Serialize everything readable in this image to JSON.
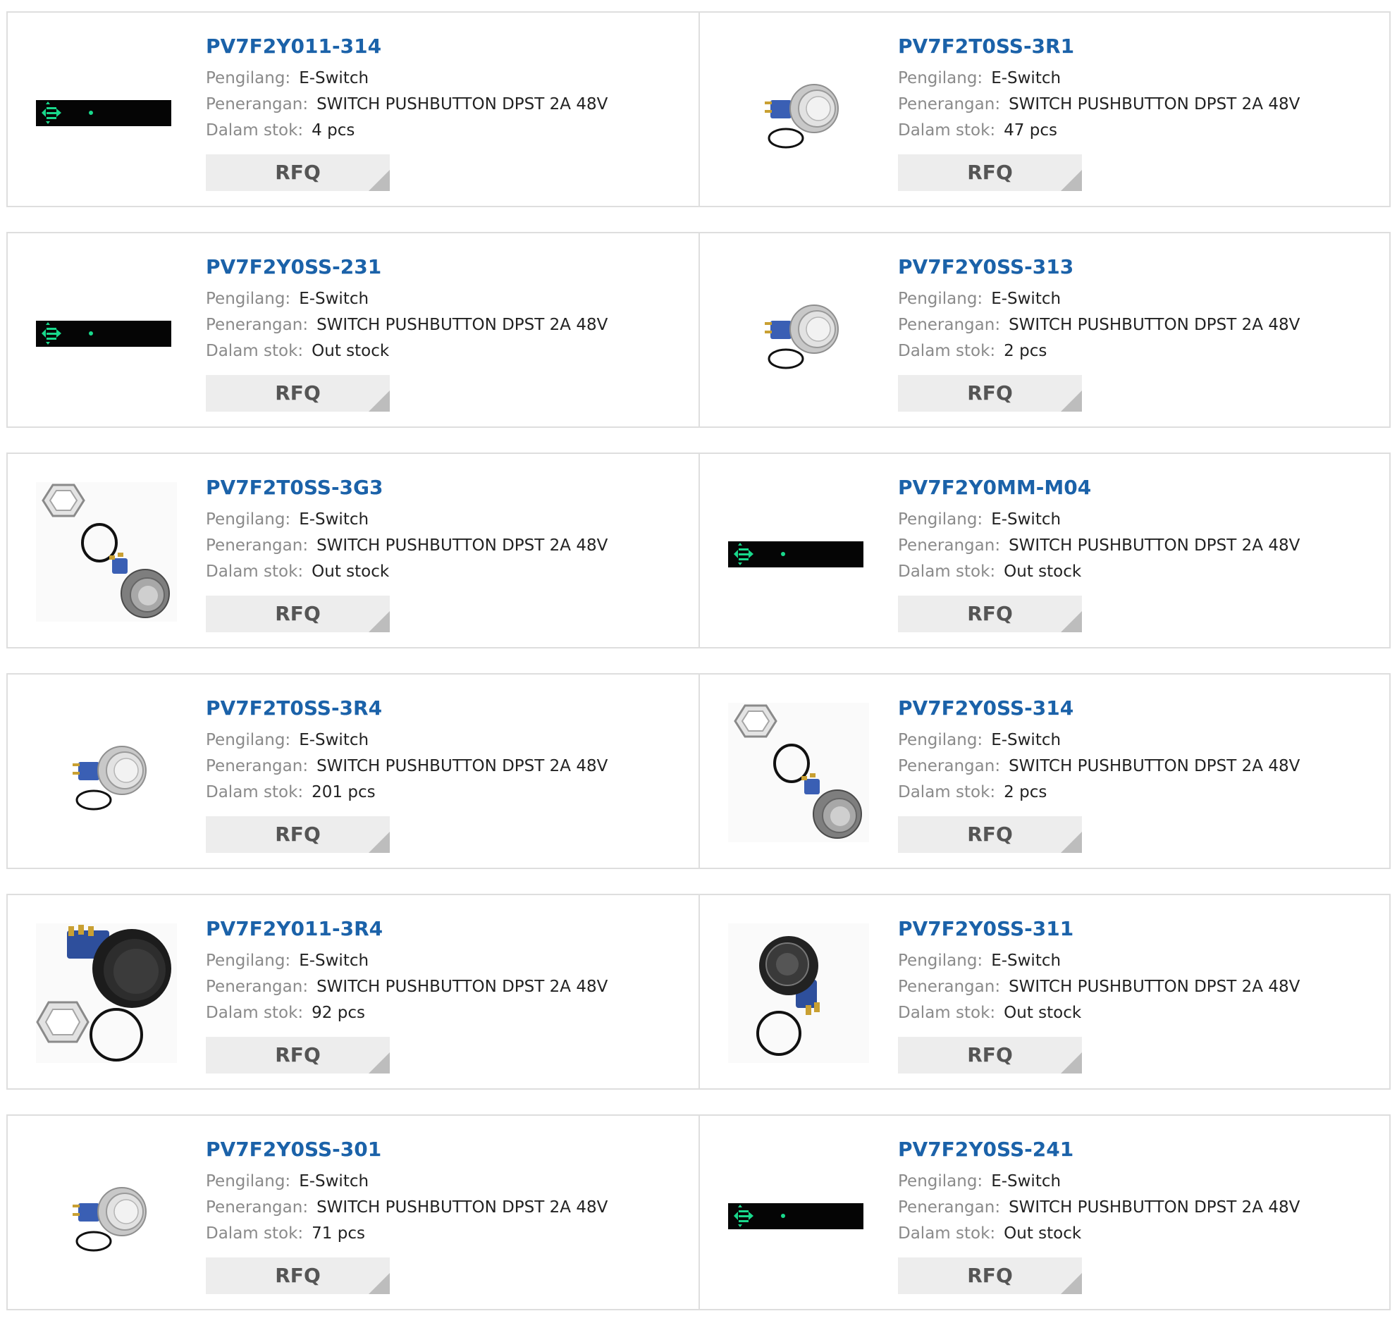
{
  "labels": {
    "manufacturer": "Pengilang:",
    "description": "Penerangan:",
    "stock": "Dalam stok:",
    "rfq": "RFQ"
  },
  "products": [
    {
      "part": "PV7F2Y011-314",
      "manufacturer": "E-Switch",
      "description": "SWITCH PUSHBUTTON DPST 2A 48V",
      "stock": "4 pcs",
      "image": "placeholder-icon"
    },
    {
      "part": "PV7F2T0SS-3R1",
      "manufacturer": "E-Switch",
      "description": "SWITCH PUSHBUTTON DPST 2A 48V",
      "stock": "47 pcs",
      "image": "silver-pushbutton"
    },
    {
      "part": "PV7F2Y0SS-231",
      "manufacturer": "E-Switch",
      "description": "SWITCH PUSHBUTTON DPST 2A 48V",
      "stock": "Out stock",
      "image": "placeholder-icon"
    },
    {
      "part": "PV7F2Y0SS-313",
      "manufacturer": "E-Switch",
      "description": "SWITCH PUSHBUTTON DPST 2A 48V",
      "stock": "2 pcs",
      "image": "silver-pushbutton"
    },
    {
      "part": "PV7F2T0SS-3G3",
      "manufacturer": "E-Switch",
      "description": "SWITCH PUSHBUTTON DPST 2A 48V",
      "stock": "Out stock",
      "image": "pushbutton-with-nut"
    },
    {
      "part": "PV7F2Y0MM-M04",
      "manufacturer": "E-Switch",
      "description": "SWITCH PUSHBUTTON DPST 2A 48V",
      "stock": "Out stock",
      "image": "placeholder-icon"
    },
    {
      "part": "PV7F2T0SS-3R4",
      "manufacturer": "E-Switch",
      "description": "SWITCH PUSHBUTTON DPST 2A 48V",
      "stock": "201 pcs",
      "image": "silver-pushbutton"
    },
    {
      "part": "PV7F2Y0SS-314",
      "manufacturer": "E-Switch",
      "description": "SWITCH PUSHBUTTON DPST 2A 48V",
      "stock": "2 pcs",
      "image": "pushbutton-with-nut"
    },
    {
      "part": "PV7F2Y011-3R4",
      "manufacturer": "E-Switch",
      "description": "SWITCH PUSHBUTTON DPST 2A 48V",
      "stock": "92 pcs",
      "image": "black-pushbutton-with-nut"
    },
    {
      "part": "PV7F2Y0SS-311",
      "manufacturer": "E-Switch",
      "description": "SWITCH PUSHBUTTON DPST 2A 48V",
      "stock": "Out stock",
      "image": "black-pushbutton"
    },
    {
      "part": "PV7F2Y0SS-301",
      "manufacturer": "E-Switch",
      "description": "SWITCH PUSHBUTTON DPST 2A 48V",
      "stock": "71 pcs",
      "image": "silver-pushbutton"
    },
    {
      "part": "PV7F2Y0SS-241",
      "manufacturer": "E-Switch",
      "description": "SWITCH PUSHBUTTON DPST 2A 48V",
      "stock": "Out stock",
      "image": "placeholder-icon"
    }
  ],
  "colors": {
    "part_link": "#1b62a9",
    "label": "#8a8a8a",
    "value": "#222222",
    "rfq_bg": "#ededed",
    "border": "#dedede",
    "placeholder_accent": "#19d98c"
  }
}
